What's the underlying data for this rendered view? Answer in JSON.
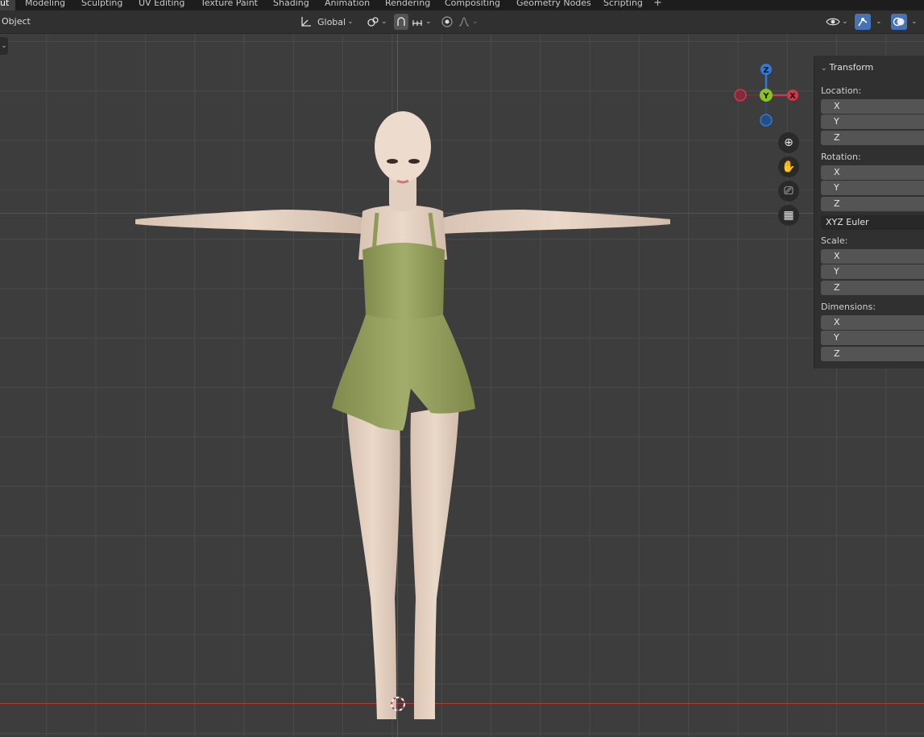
{
  "workspace_tabs": [
    {
      "label": "ut",
      "active": true
    },
    {
      "label": "Modeling"
    },
    {
      "label": "Sculpting"
    },
    {
      "label": "UV Editing"
    },
    {
      "label": "Texture Paint"
    },
    {
      "label": "Shading"
    },
    {
      "label": "Animation"
    },
    {
      "label": "Rendering"
    },
    {
      "label": "Compositing"
    },
    {
      "label": "Geometry Nodes"
    },
    {
      "label": "Scripting"
    }
  ],
  "add_workspace_label": "+",
  "header": {
    "mode_label": "Object",
    "transform_orientation": "Global",
    "pivot_icon": "transform-orientation-icon",
    "snap_icon": "snap-icon",
    "proportional_icon": "proportional-edit-icon",
    "accent_color": "#4772b3"
  },
  "gizmo": {
    "z_label": "Z",
    "y_label": "Y",
    "x_label": "X",
    "colors": {
      "x": "#d0374b",
      "y": "#8cc21f",
      "z": "#2f7ad6"
    }
  },
  "nav_buttons": [
    {
      "name": "zoom-icon",
      "glyph": "⊕"
    },
    {
      "name": "hand-icon",
      "glyph": "✋"
    },
    {
      "name": "camera-icon",
      "glyph": "⎚"
    },
    {
      "name": "grid-icon",
      "glyph": "▦"
    }
  ],
  "npanel": {
    "title": "Transform",
    "location_label": "Location:",
    "location": [
      "X",
      "Y",
      "Z"
    ],
    "rotation_label": "Rotation:",
    "rotation": [
      "X",
      "Y",
      "Z"
    ],
    "rotation_mode": "XYZ Euler",
    "scale_label": "Scale:",
    "scale": [
      "X",
      "Y",
      "Z"
    ],
    "dimensions_label": "Dimensions:",
    "dimensions": [
      "X",
      "Y",
      "Z"
    ]
  }
}
